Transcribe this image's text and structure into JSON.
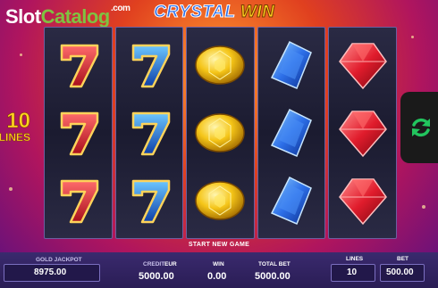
{
  "watermark": {
    "part1": "Slot",
    "part2": "Catalog",
    "part3": ".com"
  },
  "logo": {
    "part1": "CRYSTAL",
    "part2": "WIN"
  },
  "lines_badge": {
    "number": "10",
    "text": "LINES"
  },
  "reels": [
    {
      "symbols": [
        "red-seven",
        "red-seven",
        "red-seven"
      ]
    },
    {
      "symbols": [
        "blue-seven",
        "blue-seven",
        "blue-seven"
      ]
    },
    {
      "symbols": [
        "yellow-diamond",
        "yellow-diamond",
        "yellow-diamond"
      ]
    },
    {
      "symbols": [
        "blue-gem",
        "blue-gem",
        "blue-gem"
      ]
    },
    {
      "symbols": [
        "red-gem",
        "red-gem",
        "red-gem"
      ]
    }
  ],
  "status": {
    "start_new_game": "START NEW GAME"
  },
  "panel": {
    "gold_jackpot_label": "GOLD JACKPOT",
    "gold_jackpot_value": "8975.00",
    "credit_label": "CREDIT",
    "currency": "EUR",
    "credit_value": "5000.00",
    "win_label": "WIN",
    "win_value": "0.00",
    "total_bet_label": "TOTAL BET",
    "total_bet_value": "5000.00",
    "lines_label": "LINES",
    "lines_value": "10",
    "bet_label": "BET",
    "bet_value": "500.00"
  },
  "colors": {
    "accent_gold": "#ffd21f",
    "reel_bg": "#1b1b30",
    "panel_bg": "#2a1d55",
    "spin_green": "#22c55e"
  },
  "icons": {
    "spin": "refresh-icon"
  }
}
